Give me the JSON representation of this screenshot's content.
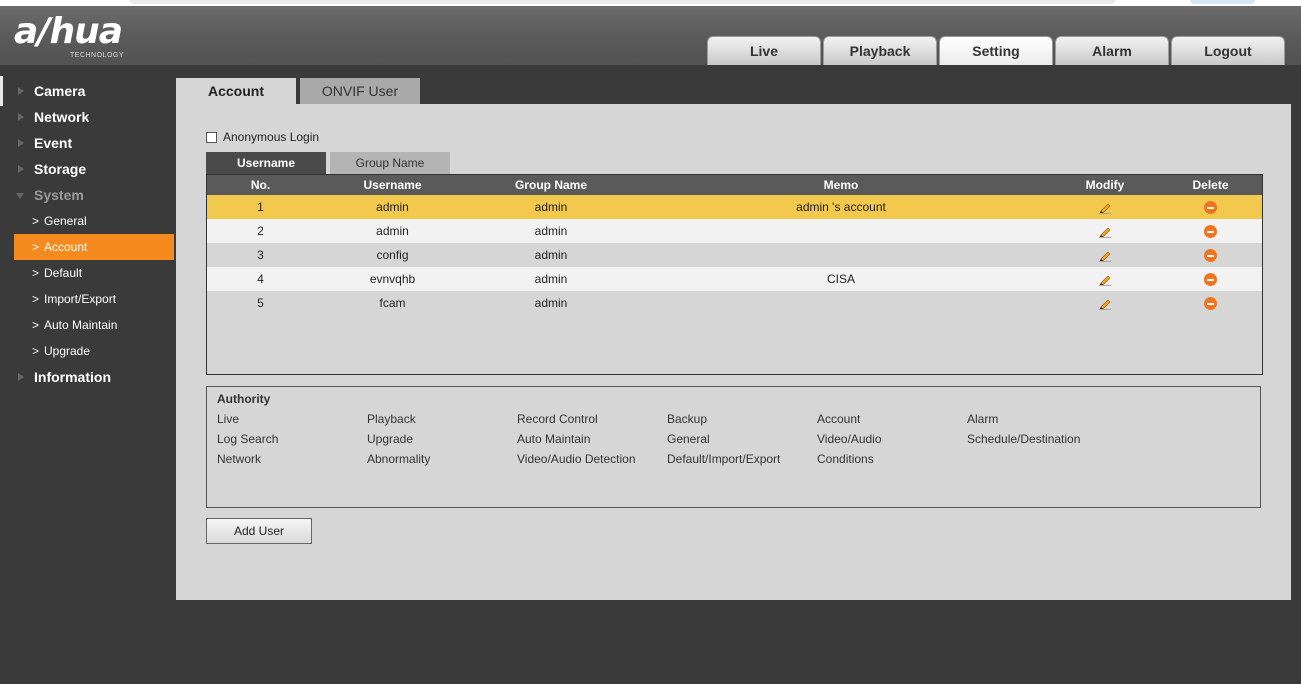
{
  "header": {
    "logo": "a/hua",
    "logo_sub": "TECHNOLOGY",
    "nav": [
      "Live",
      "Playback",
      "Setting",
      "Alarm",
      "Logout"
    ],
    "active_nav": "Setting"
  },
  "sidebar": {
    "items": [
      {
        "label": "Camera"
      },
      {
        "label": "Network"
      },
      {
        "label": "Event"
      },
      {
        "label": "Storage"
      },
      {
        "label": "System"
      }
    ],
    "system_sub": [
      "General",
      "Account",
      "Default",
      "Import/Export",
      "Auto Maintain",
      "Upgrade"
    ],
    "last_item": "Information",
    "active_sub": "Account"
  },
  "main": {
    "tabs": [
      "Account",
      "ONVIF User"
    ],
    "anonymous_login": "Anonymous Login",
    "subtabs": [
      "Username",
      "Group Name"
    ],
    "table": {
      "headers": [
        "No.",
        "Username",
        "Group Name",
        "Memo",
        "Modify",
        "Delete"
      ],
      "rows": [
        {
          "no": "1",
          "user": "admin",
          "group": "admin",
          "memo": "admin 's account"
        },
        {
          "no": "2",
          "user": "admin",
          "group": "admin",
          "memo": ""
        },
        {
          "no": "3",
          "user": "config",
          "group": "admin",
          "memo": ""
        },
        {
          "no": "4",
          "user": "evnvqhb",
          "group": "admin",
          "memo": "CISA"
        },
        {
          "no": "5",
          "user": "fcam",
          "group": "admin",
          "memo": ""
        }
      ]
    },
    "authority": {
      "title": "Authority",
      "items": [
        [
          "Live",
          "Playback",
          "Record Control",
          "Backup",
          "Account",
          "Alarm"
        ],
        [
          "Log Search",
          "Upgrade",
          "Auto Maintain",
          "General",
          "Video/Audio",
          "Schedule/Destination"
        ],
        [
          "Network",
          "Abnormality",
          "Video/Audio Detection",
          "Default/Import/Export",
          "Conditions"
        ]
      ]
    },
    "add_user": "Add User"
  },
  "colors": {
    "accent": "#f58a1f",
    "selected_row": "#f2c94c",
    "delete": "#f0741f"
  }
}
